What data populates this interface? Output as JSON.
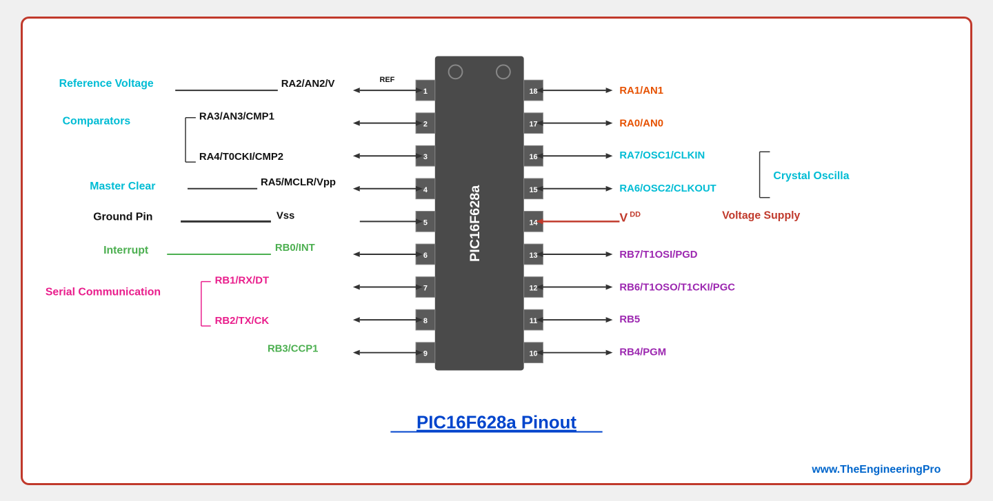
{
  "diagram": {
    "title": "PIC16F628a Pinout",
    "website": "www.TheEngineeringPro",
    "ic_label": "PIC16F628a",
    "colors": {
      "cyan": "#00bcd4",
      "blue": "#0044cc",
      "green": "#4caf50",
      "red": "#c0392b",
      "purple": "#9c27b0",
      "pink": "#e91e8c",
      "darkred": "#b71c1c",
      "orange": "#e65100",
      "black": "#111111",
      "teal": "#00897b"
    },
    "left_pins": [
      {
        "num": 1,
        "name": "RA2/AN2/V",
        "sub": "REF",
        "label": "Reference Voltage",
        "labelColor": "#00bcd4",
        "lineStyle": "single"
      },
      {
        "num": 2,
        "name": "RA3/AN3/CMP1",
        "label": "Comparators",
        "labelColor": "#00bcd4",
        "group": "top"
      },
      {
        "num": 3,
        "name": "RA4/T0CKI/CMP2",
        "labelColor": "#00bcd4",
        "group": "bottom"
      },
      {
        "num": 4,
        "name": "RA5/MCLR/Vpp",
        "label": "Master Clear",
        "labelColor": "#00bcd4",
        "lineStyle": "single"
      },
      {
        "num": 5,
        "name": "Vss",
        "label": "Ground Pin",
        "labelColor": "#111111",
        "lineStyle": "double"
      },
      {
        "num": 6,
        "name": "RB0/INT",
        "label": "Interrupt",
        "labelColor": "#4caf50",
        "lineStyle": "single"
      },
      {
        "num": 7,
        "name": "RB1/RX/DT",
        "label": "Serial Communication",
        "labelColor": "#e91e8c",
        "group": "top"
      },
      {
        "num": 8,
        "name": "RB2/TX/CK",
        "labelColor": "#e91e8c",
        "group": "bottom"
      },
      {
        "num": 9,
        "name": "RB3/CCP1",
        "labelColor": "#4caf50"
      }
    ],
    "right_pins": [
      {
        "num": 18,
        "name": "RA1/AN1",
        "color": "#e65100"
      },
      {
        "num": 17,
        "name": "RA0/AN0",
        "color": "#e65100"
      },
      {
        "num": 16,
        "name": "RA7/OSC1/CLKIN",
        "color": "#00bcd4",
        "group": "top"
      },
      {
        "num": 15,
        "name": "RA6/OSC2/CLKOUT",
        "color": "#00bcd4",
        "group": "bottom",
        "groupLabel": "Crystal Oscilla"
      },
      {
        "num": 14,
        "name": "V",
        "sub": "DD",
        "label": "Voltage Supply",
        "labelColor": "#c0392b",
        "color": "#c0392b"
      },
      {
        "num": 13,
        "name": "RB7/T1OSI/PGD",
        "color": "#9c27b0"
      },
      {
        "num": 12,
        "name": "RB6/T1OSO/T1CKI/PGC",
        "color": "#9c27b0"
      },
      {
        "num": 11,
        "name": "RB5",
        "color": "#9c27b0"
      },
      {
        "num": 10,
        "name": "RB4/PGM",
        "color": "#9c27b0"
      }
    ]
  }
}
